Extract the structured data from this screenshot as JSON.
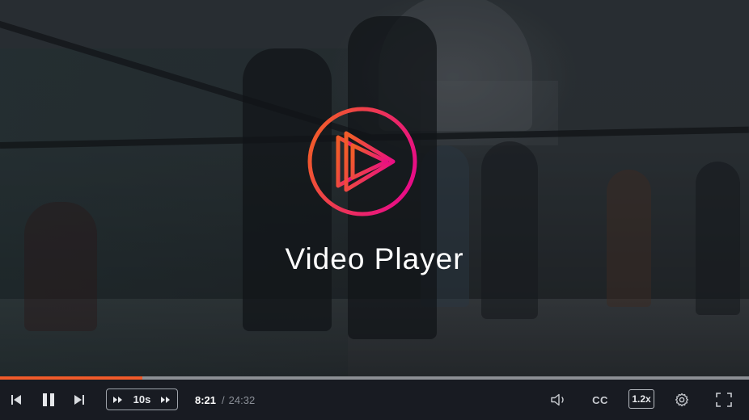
{
  "video": {
    "title": "Video Player",
    "progress_fraction": 0.19
  },
  "colors": {
    "accent": "#f15b2a",
    "logo_gradient_start": "#f15b2a",
    "logo_gradient_end": "#e80a89",
    "controls_bg": "#181b22"
  },
  "controls": {
    "skip_label": "10s",
    "current_time": "8:21",
    "time_separator": "/",
    "duration": "24:32",
    "captions_label": "CC",
    "speed_label": "1.2x"
  },
  "icons": {
    "previous": "skip-previous-icon",
    "pause": "pause-icon",
    "next": "skip-next-icon",
    "rewind": "rewind-icon",
    "forward": "fast-forward-icon",
    "volume": "volume-icon",
    "settings": "gear-icon",
    "fullscreen": "fullscreen-icon",
    "logo": "play-logo-icon"
  }
}
